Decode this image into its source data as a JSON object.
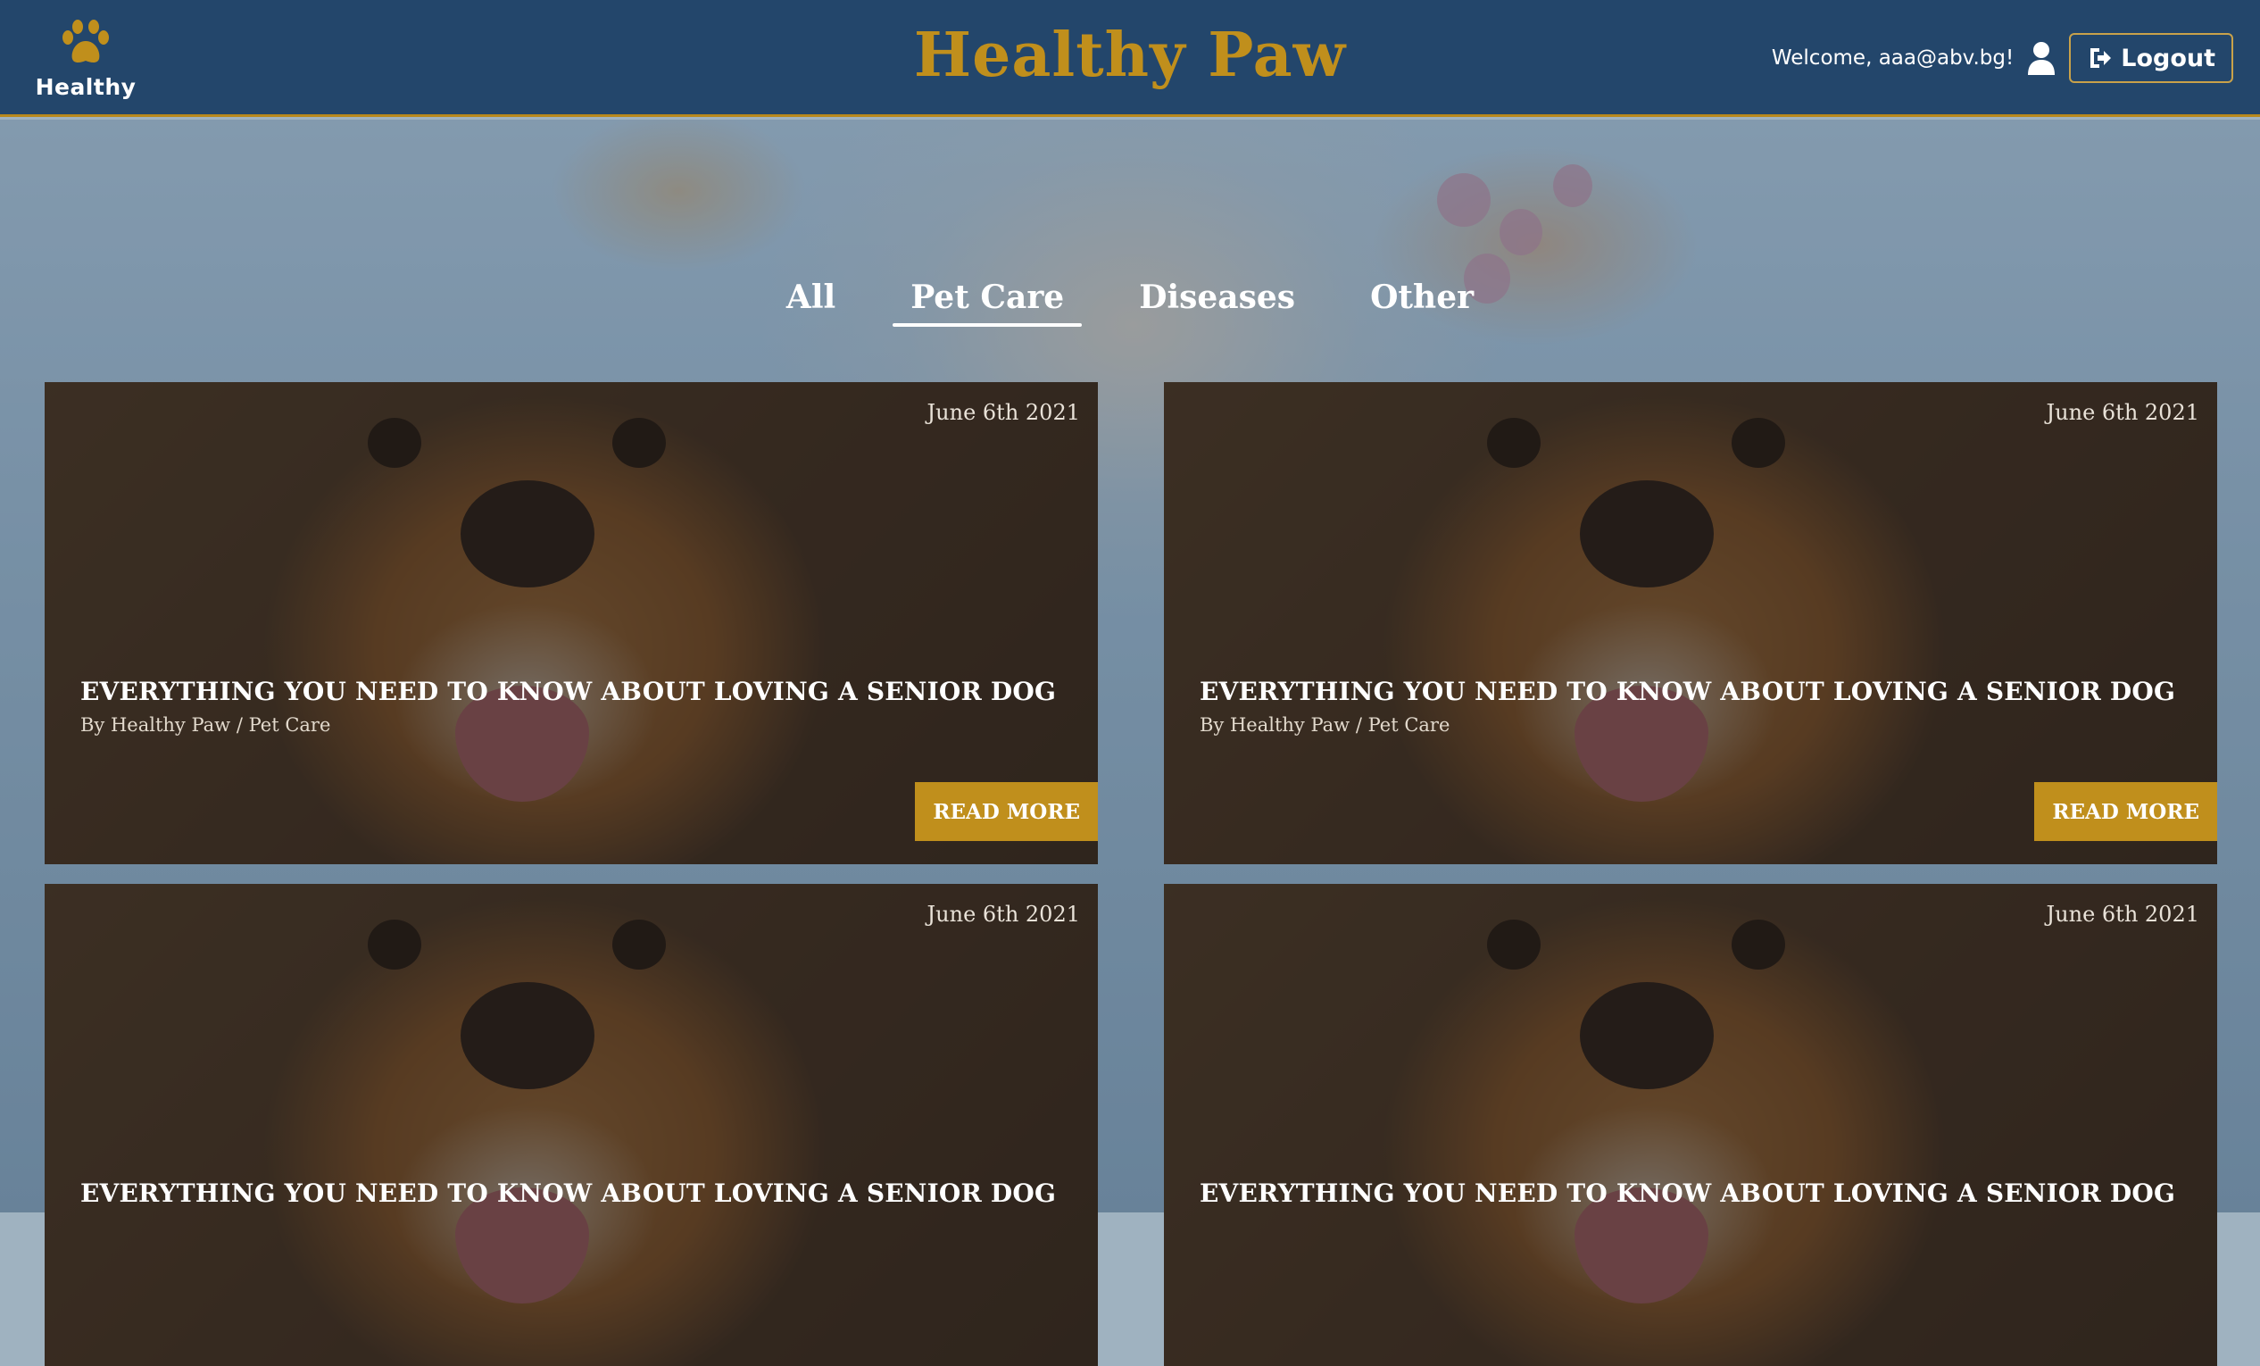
{
  "header": {
    "brand_label": "Healthy",
    "site_title": "Healthy Paw",
    "welcome_text": "Welcome, aaa@abv.bg!",
    "logout_label": "Logout"
  },
  "categories": {
    "items": [
      {
        "label": "All",
        "active": false
      },
      {
        "label": "Pet Care",
        "active": true
      },
      {
        "label": "Diseases",
        "active": false
      },
      {
        "label": "Other",
        "active": false
      }
    ]
  },
  "posts": [
    {
      "date": "June 6th 2021",
      "title": "EVERYTHING YOU NEED TO KNOW ABOUT LOVING A SENIOR DOG",
      "author": "By Healthy Paw",
      "separator": "/",
      "category": "Pet Care",
      "button": "READ MORE"
    },
    {
      "date": "June 6th 2021",
      "title": "EVERYTHING YOU NEED TO KNOW ABOUT LOVING A SENIOR DOG",
      "author": "By Healthy Paw",
      "separator": "/",
      "category": "Pet Care",
      "button": "READ MORE"
    },
    {
      "date": "June 6th 2021",
      "title": "EVERYTHING YOU NEED TO KNOW ABOUT LOVING A SENIOR DOG",
      "author": "",
      "separator": "",
      "category": "",
      "button": ""
    },
    {
      "date": "June 6th 2021",
      "title": "EVERYTHING YOU NEED TO KNOW ABOUT LOVING A SENIOR DOG",
      "author": "",
      "separator": "",
      "category": "",
      "button": ""
    }
  ],
  "colors": {
    "header_bg": "#23466b",
    "accent_gold": "#c08f1c",
    "text_white": "#ffffff"
  },
  "icons": {
    "brand": "paw-icon",
    "user": "user-icon",
    "logout": "logout-icon"
  }
}
